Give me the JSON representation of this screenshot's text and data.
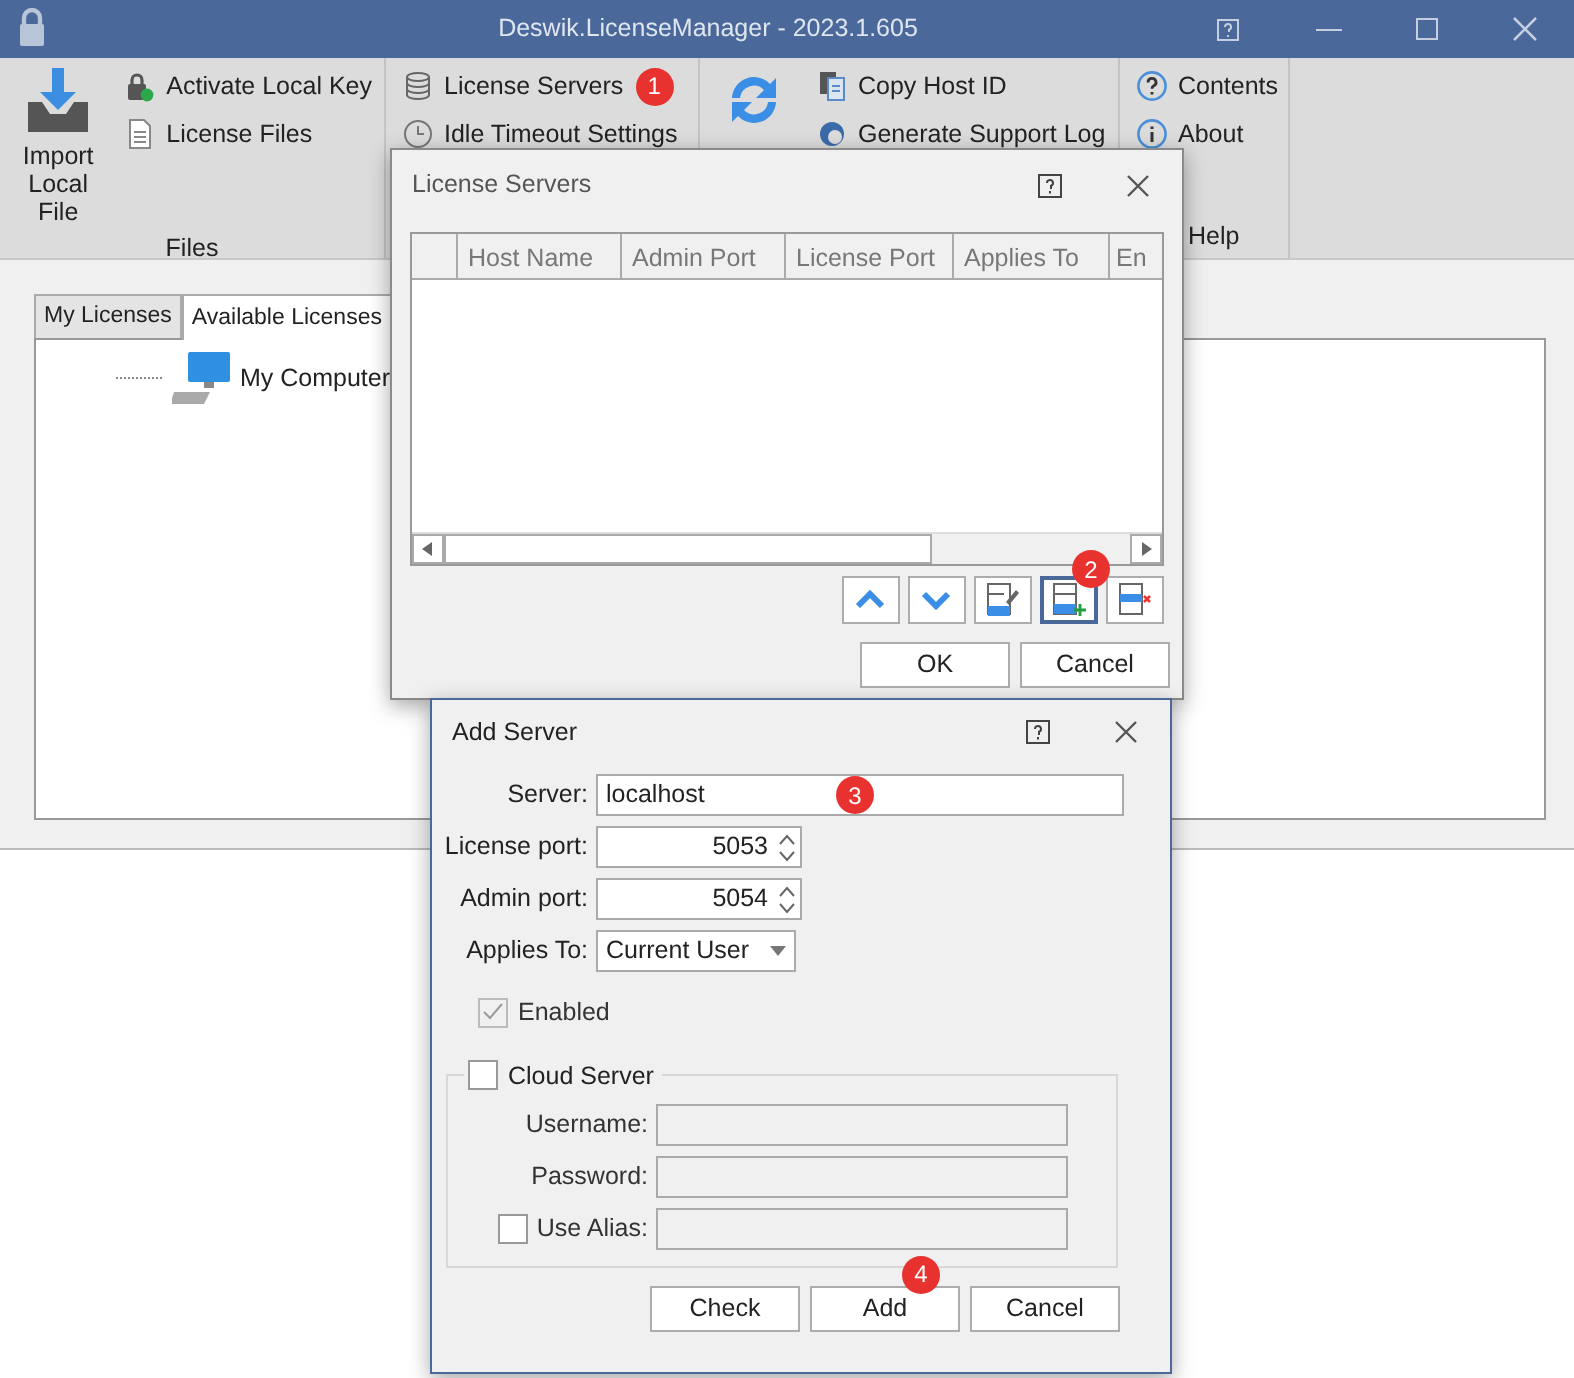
{
  "window": {
    "title": "Deswik.LicenseManager - 2023.1.605"
  },
  "ribbon": {
    "groups": [
      {
        "kind": "large_text",
        "label": "Files",
        "large": "Import Local File",
        "items": [
          {
            "label": "Activate Local Key"
          },
          {
            "label": "License Files"
          }
        ]
      },
      {
        "kind": "small",
        "items": [
          {
            "label": "License Servers",
            "badge": "1"
          },
          {
            "label": "Idle Timeout Settings"
          }
        ]
      },
      {
        "kind": "icon_only",
        "items": [
          {
            "label": "Copy Host ID"
          },
          {
            "label": "Generate Support Log"
          }
        ]
      },
      {
        "kind": "small",
        "label": "Help",
        "items": [
          {
            "label": "Contents"
          },
          {
            "label": "About"
          }
        ]
      }
    ]
  },
  "tabs": [
    {
      "label": "My Licenses",
      "selected": false
    },
    {
      "label": "Available Licenses",
      "selected": true
    }
  ],
  "tree": [
    {
      "label": "My Computer"
    }
  ],
  "license_servers_dialog": {
    "title": "License Servers",
    "columns": [
      "Host Name",
      "Admin Port",
      "License Port",
      "Applies To",
      "En"
    ],
    "toolbar": [
      {
        "kind": "up",
        "focused": false
      },
      {
        "kind": "down",
        "focused": false
      },
      {
        "kind": "edit",
        "focused": false
      },
      {
        "kind": "add",
        "focused": true,
        "badge": "2"
      },
      {
        "kind": "delete",
        "focused": false
      }
    ],
    "buttons": [
      "OK",
      "Cancel"
    ]
  },
  "add_server_dialog": {
    "title": "Add Server",
    "fields": [
      {
        "kind": "text",
        "label": "Server:",
        "value": "localhost",
        "badge": "3"
      },
      {
        "kind": "spin",
        "label": "License port:",
        "value": "5053"
      },
      {
        "kind": "spin",
        "label": "Admin port:",
        "value": "5054"
      },
      {
        "kind": "select",
        "label": "Applies To:",
        "value": "Current User"
      }
    ],
    "enabled": {
      "label": "Enabled",
      "checked": true,
      "disabled": true
    },
    "cloud": {
      "label": "Cloud Server",
      "checked": false,
      "fields": [
        {
          "label": "Username:",
          "disabled": true
        },
        {
          "label": "Password:",
          "disabled": true
        },
        {
          "kind": "checkbox",
          "label": "Use Alias:",
          "checked": false,
          "disabled": true
        }
      ]
    },
    "buttons": [
      {
        "label": "Check"
      },
      {
        "label": "Add",
        "badge": "4"
      },
      {
        "label": "Cancel"
      }
    ]
  }
}
